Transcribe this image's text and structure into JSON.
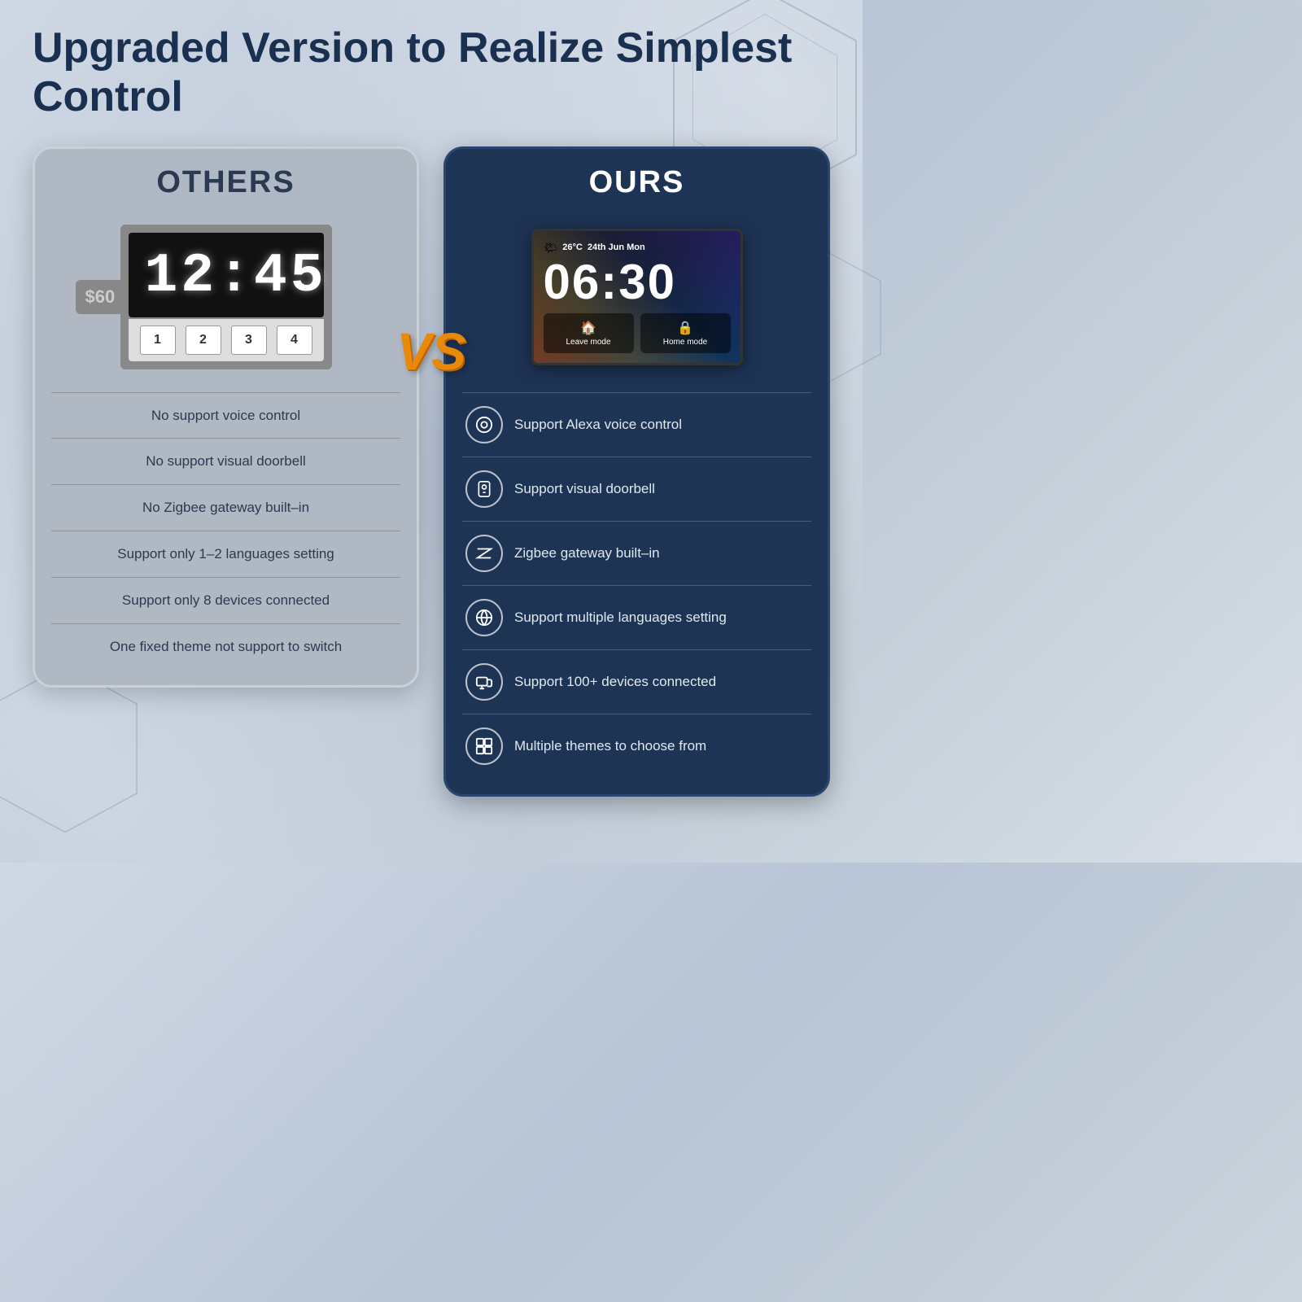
{
  "page": {
    "title_line1": "Upgraded Version to Realize Simplest",
    "title_line2": "Control",
    "vs_text": "VS"
  },
  "others_card": {
    "header": "OTHERS",
    "price": "$60",
    "clock_time": "12:45",
    "buttons": [
      "1",
      "2",
      "3",
      "4"
    ],
    "features": [
      "No support voice control",
      "No support visual doorbell",
      "No Zigbee gateway built–in",
      "Support only 1–2 languages setting",
      "Support only 8 devices connected",
      "One fixed theme not support to switch"
    ]
  },
  "ours_card": {
    "header": "OURS",
    "weather": "26°C",
    "date": "24th Jun Mon",
    "time": "06:30",
    "mode1": "Leave mode",
    "mode2": "Home mode",
    "features": [
      {
        "icon": "alexa",
        "text": "Support Alexa voice control"
      },
      {
        "icon": "doorbell",
        "text": "Support visual doorbell"
      },
      {
        "icon": "zigbee",
        "text": "Zigbee gateway built–in"
      },
      {
        "icon": "globe",
        "text": "Support multiple languages setting"
      },
      {
        "icon": "devices",
        "text": "Support 100+ devices connected"
      },
      {
        "icon": "themes",
        "text": "Multiple themes to choose from"
      }
    ]
  }
}
